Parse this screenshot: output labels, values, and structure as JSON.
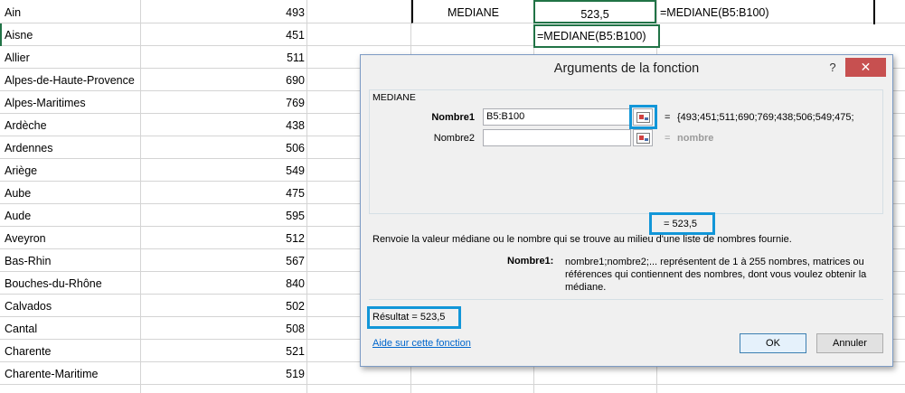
{
  "sheet": {
    "rows": [
      {
        "name": "Ain",
        "value": "493"
      },
      {
        "name": "Aisne",
        "value": "451"
      },
      {
        "name": "Allier",
        "value": "511"
      },
      {
        "name": "Alpes-de-Haute-Provence",
        "value": "690"
      },
      {
        "name": "Alpes-Maritimes",
        "value": "769"
      },
      {
        "name": "Ardèche",
        "value": "438"
      },
      {
        "name": "Ardennes",
        "value": "506"
      },
      {
        "name": "Ariège",
        "value": "549"
      },
      {
        "name": "Aube",
        "value": "475"
      },
      {
        "name": "Aude",
        "value": "595"
      },
      {
        "name": "Aveyron",
        "value": "512"
      },
      {
        "name": "Bas-Rhin",
        "value": "567"
      },
      {
        "name": "Bouches-du-Rhône",
        "value": "840"
      },
      {
        "name": "Calvados",
        "value": "502"
      },
      {
        "name": "Cantal",
        "value": "508"
      },
      {
        "name": "Charente",
        "value": "521"
      },
      {
        "name": "Charente-Maritime",
        "value": "519"
      }
    ],
    "median_label": "MEDIANE",
    "median_value": "523,5",
    "median_formula": "=MEDIANE(B5:B100)",
    "edit_formula": "=MEDIANE(B5:B100)"
  },
  "dialog": {
    "title": "Arguments de la fonction",
    "help_glyph": "?",
    "close_glyph": "✕",
    "function_name": "MEDIANE",
    "arg1_label": "Nombre1",
    "arg1_value": "B5:B100",
    "arg1_eval_eq": "=",
    "arg1_eval": "{493;451;511;690;769;438;506;549;475;",
    "arg2_label": "Nombre2",
    "arg2_value": "",
    "arg2_eval_eq": "=",
    "arg2_eval": "nombre",
    "formula_result": "=   523,5",
    "description": "Renvoie la valeur médiane ou le nombre qui se trouve au milieu d'une liste de nombres fournie.",
    "param_name": "Nombre1:",
    "param_description": "nombre1;nombre2;... représentent de 1 à 255 nombres, matrices ou références qui contiennent des nombres, dont vous voulez obtenir la médiane.",
    "result_text": "Résultat =    523,5",
    "help_link": "Aide sur cette fonction",
    "ok_label": "OK",
    "cancel_label": "Annuler"
  }
}
